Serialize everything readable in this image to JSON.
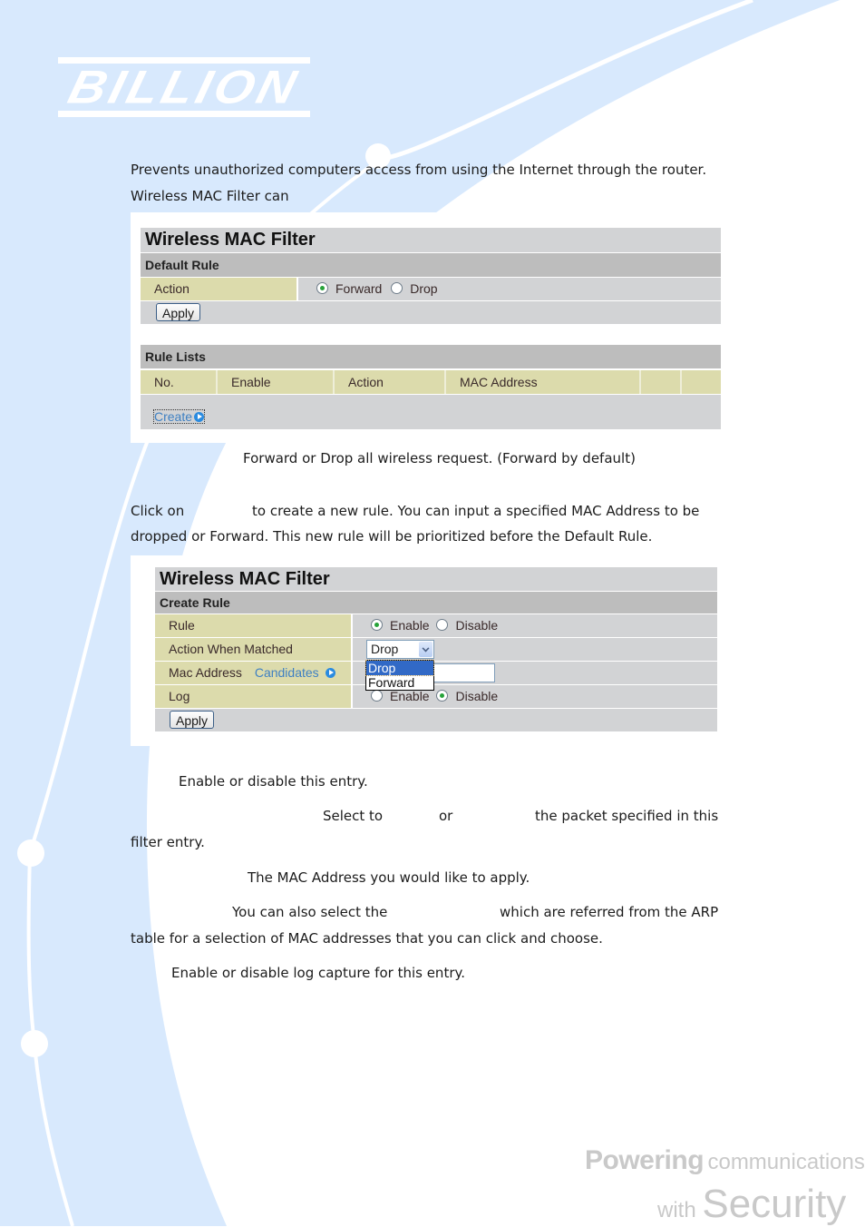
{
  "brand": {
    "logo": "BILLION",
    "slogan_line1_bold": "Powering",
    "slogan_line1_rest": "communications",
    "slogan_line2_small": "with",
    "slogan_line2_big": "Security"
  },
  "intro": {
    "line1": "Prevents unauthorized computers access from using the Internet through the router.",
    "line2": "Wireless MAC Filter can"
  },
  "panel1": {
    "title": "Wireless MAC Filter",
    "section_default": "Default Rule",
    "action_label": "Action",
    "action_options": [
      {
        "label": "Forward",
        "selected": true
      },
      {
        "label": "Drop",
        "selected": false
      }
    ],
    "apply_label": "Apply",
    "section_rules": "Rule Lists",
    "columns": [
      "No.",
      "Enable",
      "Action",
      "MAC Address",
      "",
      ""
    ],
    "rows": [],
    "create_label": "Create"
  },
  "desc_default": "Forward or Drop all wireless request. (Forward by default)",
  "create_para": {
    "line1_a": "Click on",
    "line1_b": "to create a new rule. You can input a specified MAC Address to be",
    "line2": "dropped or Forward. This new rule will be prioritized before the Default Rule."
  },
  "panel2": {
    "title": "Wireless MAC Filter",
    "section": "Create Rule",
    "rule_label": "Rule",
    "rule_options": [
      {
        "label": "Enable",
        "selected": true
      },
      {
        "label": "Disable",
        "selected": false
      }
    ],
    "action_label": "Action When Matched",
    "action_value": "Drop",
    "action_dropdown_options": [
      {
        "label": "Drop",
        "highlighted": true
      },
      {
        "label": "Forward",
        "highlighted": false
      }
    ],
    "mac_label": "Mac Address",
    "candidates_label": "Candidates",
    "mac_value": "",
    "log_label": "Log",
    "log_options": [
      {
        "label": "Enable",
        "selected": false
      },
      {
        "label": "Disable",
        "selected": true
      }
    ],
    "apply_label": "Apply"
  },
  "descriptions": {
    "rule": "Enable or disable this entry.",
    "action_a": "Select to",
    "action_b": "or",
    "action_c": "the packet specified in this",
    "action_line2": "filter entry.",
    "mac": "The MAC Address you would like to apply.",
    "candidates_a": "You can also select the",
    "candidates_b": "which are referred from the ARP",
    "candidates_line2": "table for a selection of MAC addresses that you can click and choose.",
    "log": "Enable or disable log capture for this entry."
  },
  "colors": {
    "bg_swoosh": "#d8e9fd",
    "label_cell": "#dcdbac",
    "section_header": "#bdbdbd",
    "row_gray": "#d2d3d5",
    "link": "#3f80c2",
    "select_highlight": "#3169c6"
  }
}
